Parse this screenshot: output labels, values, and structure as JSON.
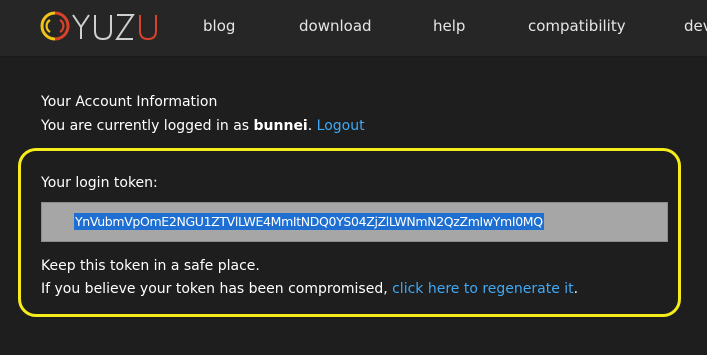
{
  "nav": {
    "brand": "yuzu",
    "items": [
      "blog",
      "download",
      "help",
      "compatibility",
      "dev"
    ]
  },
  "account": {
    "heading": "Your Account Information",
    "logged_in_prefix": "You are currently logged in as ",
    "username": "bunnei",
    "logged_in_suffix": ". ",
    "logout_label": "Logout"
  },
  "token_section": {
    "label": "Your login token:",
    "value": "YnVubmVpOmE2NGU1ZTVlLWE4MmItNDQ0YS04ZjZlLWNmN2QzZmIwYmI0MQ",
    "keep_safe_text": "Keep this token in a safe place.",
    "compromised_prefix": "If you believe your token has been compromised, ",
    "regenerate_label": "click here to regenerate it",
    "compromised_suffix": "."
  },
  "colors": {
    "background": "#1e1e1e",
    "navbar": "#262626",
    "link": "#3fa9f5",
    "highlight_border": "#f6ec1c",
    "token_field": "#a6a6a6",
    "selection": "#1e6fd1"
  }
}
